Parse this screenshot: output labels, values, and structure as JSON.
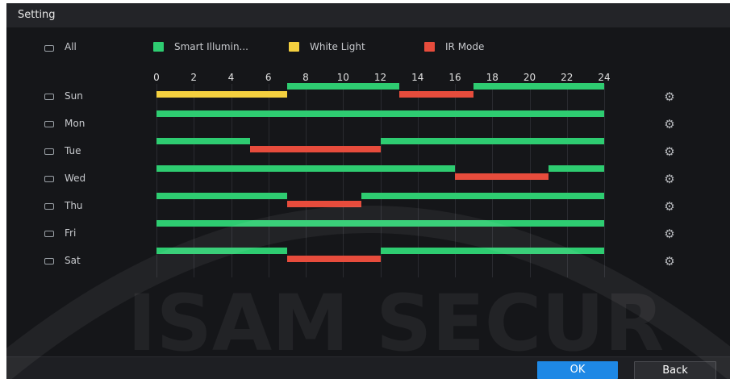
{
  "window": {
    "title": "Setting"
  },
  "legend": {
    "all_label": "All",
    "items": [
      {
        "label": "Smart Illumin...",
        "color": "#2ecc71"
      },
      {
        "label": "White Light",
        "color": "#f4d03f"
      },
      {
        "label": "IR Mode",
        "color": "#e74c3c"
      }
    ]
  },
  "timeline": {
    "ticks": [
      "0",
      "2",
      "4",
      "6",
      "8",
      "10",
      "12",
      "14",
      "16",
      "18",
      "20",
      "22",
      "24"
    ],
    "range_hours": [
      0,
      24
    ]
  },
  "days": [
    {
      "label": "Sun",
      "segments": [
        {
          "mode": "white",
          "start": 0,
          "end": 7
        },
        {
          "mode": "smart",
          "start": 7,
          "end": 13
        },
        {
          "mode": "ir",
          "start": 13,
          "end": 17
        },
        {
          "mode": "smart",
          "start": 17,
          "end": 24
        }
      ]
    },
    {
      "label": "Mon",
      "segments": [
        {
          "mode": "smart",
          "start": 0,
          "end": 24
        }
      ]
    },
    {
      "label": "Tue",
      "segments": [
        {
          "mode": "smart",
          "start": 0,
          "end": 5
        },
        {
          "mode": "ir",
          "start": 5,
          "end": 12
        },
        {
          "mode": "smart",
          "start": 12,
          "end": 24
        }
      ]
    },
    {
      "label": "Wed",
      "segments": [
        {
          "mode": "smart",
          "start": 0,
          "end": 16
        },
        {
          "mode": "ir",
          "start": 16,
          "end": 21
        },
        {
          "mode": "smart",
          "start": 21,
          "end": 24
        }
      ]
    },
    {
      "label": "Thu",
      "segments": [
        {
          "mode": "smart",
          "start": 0,
          "end": 7
        },
        {
          "mode": "ir",
          "start": 7,
          "end": 11
        },
        {
          "mode": "smart",
          "start": 11,
          "end": 24
        }
      ]
    },
    {
      "label": "Fri",
      "segments": [
        {
          "mode": "smart",
          "start": 0,
          "end": 24
        }
      ]
    },
    {
      "label": "Sat",
      "segments": [
        {
          "mode": "smart",
          "start": 0,
          "end": 7
        },
        {
          "mode": "ir",
          "start": 7,
          "end": 12
        },
        {
          "mode": "smart",
          "start": 12,
          "end": 24
        }
      ]
    }
  ],
  "mode_colors": {
    "smart": "#2ecc71",
    "white": "#f4d03f",
    "ir": "#e74c3c"
  },
  "gear_icon": "gear-icon",
  "buttons": {
    "ok": "OK",
    "back": "Back"
  },
  "watermark": {
    "text": "ISAM SECUR"
  }
}
